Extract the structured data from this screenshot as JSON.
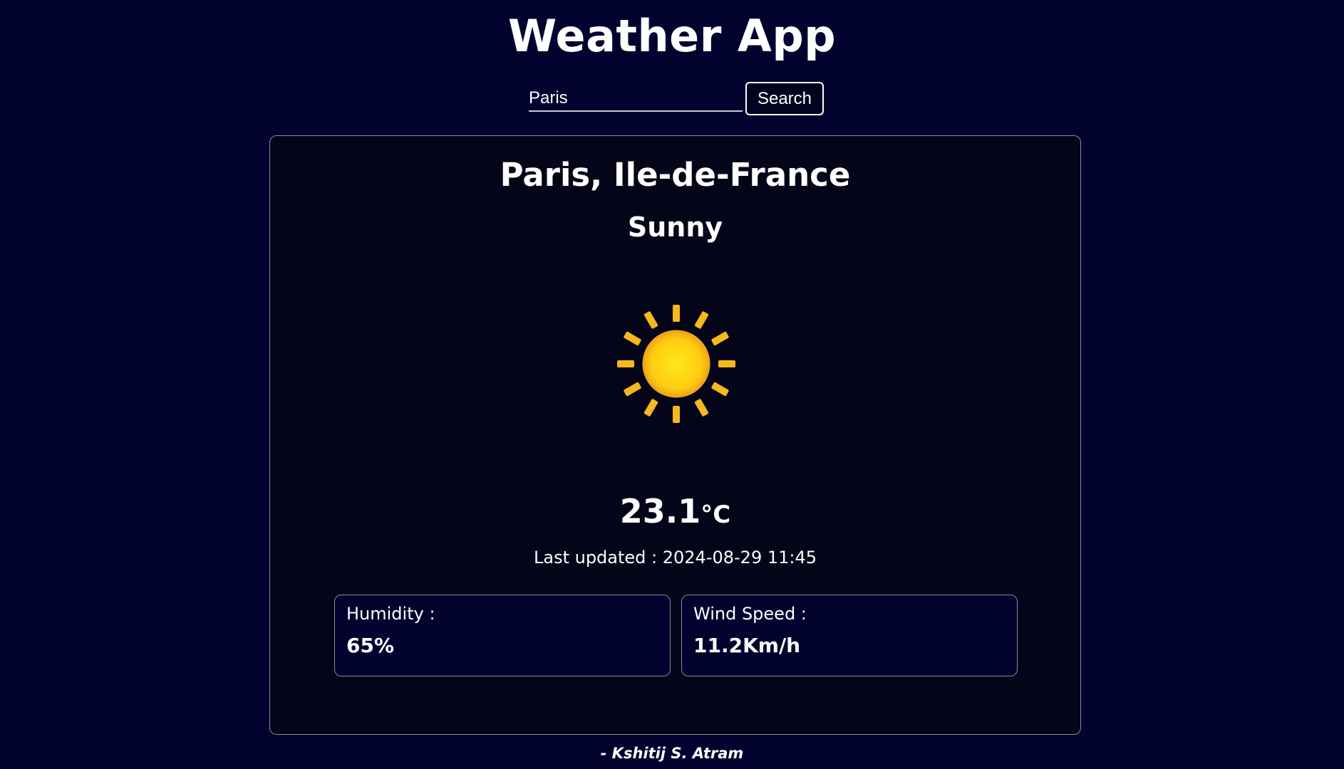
{
  "app": {
    "title": "Weather App"
  },
  "search": {
    "value": "Paris",
    "button_label": "Search"
  },
  "weather": {
    "location": "Paris, Ile-de-France",
    "condition": "Sunny",
    "icon": "sun-icon",
    "temperature": "23.1",
    "temperature_unit": "°C",
    "last_updated": "Last updated : 2024-08-29 11:45",
    "humidity_label": "Humidity :",
    "humidity_value": "65%",
    "wind_label": "Wind Speed :",
    "wind_value": "11.2Km/h"
  },
  "footer": {
    "author": "- Kshitij S. Atram"
  },
  "colors": {
    "background": "#02022e",
    "card": "#050519",
    "text": "#ffffff",
    "sun_core": "#ffd21a",
    "sun_rays": "#f7b81e"
  }
}
